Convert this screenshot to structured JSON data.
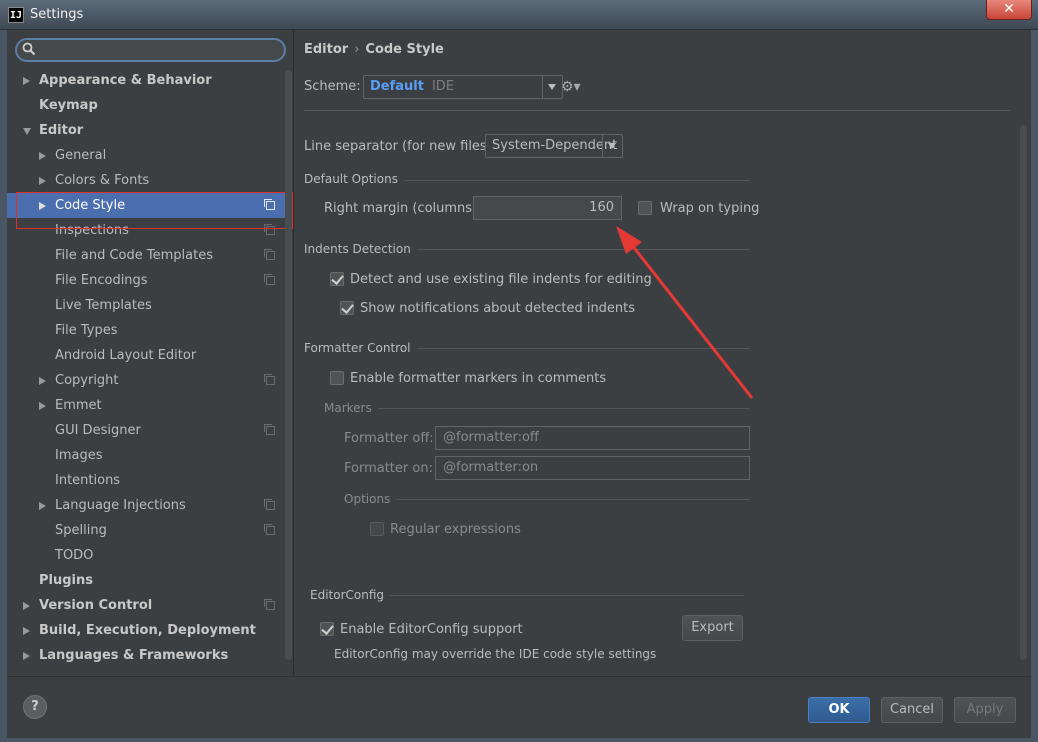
{
  "window": {
    "title": "Settings",
    "app_icon": "IJ",
    "close_label": "✕"
  },
  "search": {
    "placeholder": ""
  },
  "sidebar": {
    "items": [
      {
        "label": "Appearance & Behavior",
        "level": 0,
        "bold": true,
        "arrow": "right",
        "copy": false
      },
      {
        "label": "Keymap",
        "level": 0,
        "bold": true,
        "arrow": null,
        "copy": false
      },
      {
        "label": "Editor",
        "level": 0,
        "bold": true,
        "arrow": "down",
        "copy": false
      },
      {
        "label": "General",
        "level": 1,
        "bold": false,
        "arrow": "right",
        "copy": false
      },
      {
        "label": "Colors & Fonts",
        "level": 1,
        "bold": false,
        "arrow": "right",
        "copy": false
      },
      {
        "label": "Code Style",
        "level": 1,
        "bold": false,
        "arrow": "right",
        "copy": true,
        "selected": true
      },
      {
        "label": "Inspections",
        "level": 1,
        "bold": false,
        "arrow": null,
        "copy": true
      },
      {
        "label": "File and Code Templates",
        "level": 1,
        "bold": false,
        "arrow": null,
        "copy": true
      },
      {
        "label": "File Encodings",
        "level": 1,
        "bold": false,
        "arrow": null,
        "copy": true
      },
      {
        "label": "Live Templates",
        "level": 1,
        "bold": false,
        "arrow": null,
        "copy": false
      },
      {
        "label": "File Types",
        "level": 1,
        "bold": false,
        "arrow": null,
        "copy": false
      },
      {
        "label": "Android Layout Editor",
        "level": 1,
        "bold": false,
        "arrow": null,
        "copy": false
      },
      {
        "label": "Copyright",
        "level": 1,
        "bold": false,
        "arrow": "right",
        "copy": true
      },
      {
        "label": "Emmet",
        "level": 1,
        "bold": false,
        "arrow": "right",
        "copy": false
      },
      {
        "label": "GUI Designer",
        "level": 1,
        "bold": false,
        "arrow": null,
        "copy": true
      },
      {
        "label": "Images",
        "level": 1,
        "bold": false,
        "arrow": null,
        "copy": false
      },
      {
        "label": "Intentions",
        "level": 1,
        "bold": false,
        "arrow": null,
        "copy": false
      },
      {
        "label": "Language Injections",
        "level": 1,
        "bold": false,
        "arrow": "right",
        "copy": true
      },
      {
        "label": "Spelling",
        "level": 1,
        "bold": false,
        "arrow": null,
        "copy": true
      },
      {
        "label": "TODO",
        "level": 1,
        "bold": false,
        "arrow": null,
        "copy": false
      },
      {
        "label": "Plugins",
        "level": 0,
        "bold": true,
        "arrow": null,
        "copy": false
      },
      {
        "label": "Version Control",
        "level": 0,
        "bold": true,
        "arrow": "right",
        "copy": true
      },
      {
        "label": "Build, Execution, Deployment",
        "level": 0,
        "bold": true,
        "arrow": "right",
        "copy": false
      },
      {
        "label": "Languages & Frameworks",
        "level": 0,
        "bold": true,
        "arrow": "right",
        "copy": false
      }
    ]
  },
  "breadcrumb": {
    "part1": "Editor",
    "sep": "›",
    "part2": "Code Style"
  },
  "scheme": {
    "label": "Scheme:",
    "value": "Default",
    "suffix": "IDE"
  },
  "line_separator": {
    "label": "Line separator (for new files):",
    "value": "System-Dependent"
  },
  "default_options": {
    "title": "Default Options",
    "right_margin_label": "Right margin (columns):",
    "right_margin_value": "160",
    "wrap_label": "Wrap on typing",
    "wrap_checked": false
  },
  "indents": {
    "title": "Indents Detection",
    "detect_label": "Detect and use existing file indents for editing",
    "detect_checked": true,
    "notify_label": "Show notifications about detected indents",
    "notify_checked": true
  },
  "formatter": {
    "title": "Formatter Control",
    "enable_label": "Enable formatter markers in comments",
    "enable_checked": false,
    "markers_title": "Markers",
    "off_label": "Formatter off:",
    "off_value": "@formatter:off",
    "on_label": "Formatter on:",
    "on_value": "@formatter:on",
    "options_title": "Options",
    "regex_label": "Regular expressions"
  },
  "editorconfig": {
    "title": "EditorConfig",
    "enable_label": "Enable EditorConfig support",
    "enable_checked": true,
    "note": "EditorConfig may override the IDE code style settings",
    "export_label": "Export"
  },
  "footer": {
    "help": "?",
    "ok": "OK",
    "cancel": "Cancel",
    "apply": "Apply"
  },
  "colors": {
    "selection": "#4b6eaf",
    "annotation": "#e53935",
    "accent": "#589df6"
  }
}
